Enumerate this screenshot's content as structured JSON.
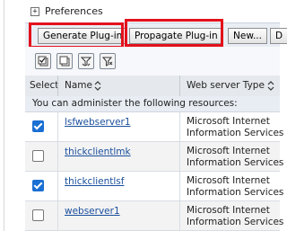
{
  "preferences": {
    "expander": "+",
    "label": "Preferences"
  },
  "toolbar": {
    "generate_label": "Generate Plug-in",
    "propagate_label": "Propagate Plug-in",
    "new_label": "New...",
    "delete_label": "D"
  },
  "icons": [
    "select-all-icon",
    "deselect-all-icon",
    "show-filter-icon",
    "clear-filter-icon"
  ],
  "table": {
    "headers": {
      "select": "Select",
      "name": "Name",
      "type": "Web server Type"
    },
    "info": "You can administer the following resources:",
    "rows": [
      {
        "name": "lsfwebserver1",
        "type1": "Microsoft Internet",
        "type2": "Information Services",
        "checked": true
      },
      {
        "name": "thickclientlmk",
        "type1": "Microsoft Internet",
        "type2": "Information Services",
        "checked": false
      },
      {
        "name": "thickclientlsf",
        "type1": "Microsoft Internet",
        "type2": "Information Services",
        "checked": true
      },
      {
        "name": "webserver1",
        "type1": "Microsoft Internet",
        "type2": "Information Services",
        "checked": false
      }
    ]
  },
  "colors": {
    "highlight": "#e3111c",
    "link": "#1a4f9c",
    "checkbox": "#1a6fd3"
  }
}
